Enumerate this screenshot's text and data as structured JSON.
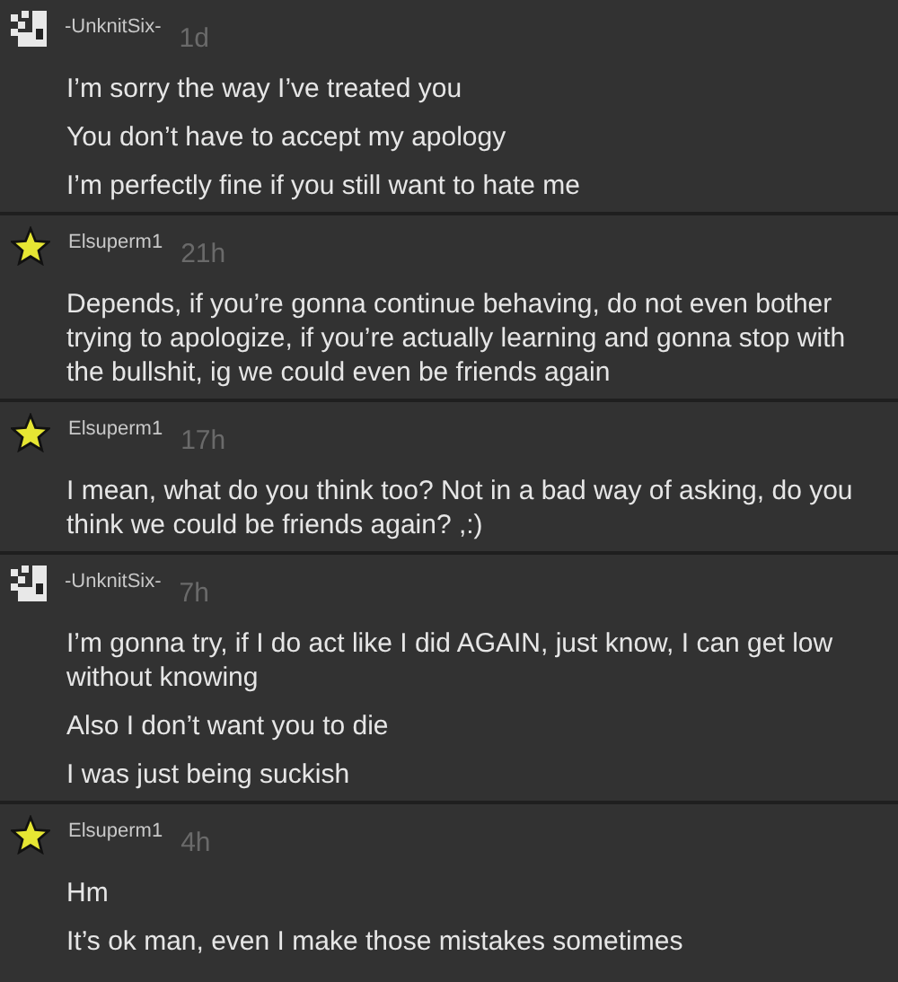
{
  "posts": [
    {
      "kind": "pixel",
      "author": "-UnknitSix-",
      "time": "1d",
      "messages": [
        "I’m sorry the way I’ve treated you",
        "You don’t have to accept my apology",
        "I’m perfectly fine if you still want to hate me"
      ]
    },
    {
      "kind": "star",
      "author": "Elsuperm1",
      "time": "21h",
      "messages": [
        "Depends, if you’re gonna continue behaving, do not even bother trying to apologize, if you’re actually learning and gonna stop with the bullshit, ig we could even be friends again"
      ]
    },
    {
      "kind": "star",
      "author": "Elsuperm1",
      "time": "17h",
      "messages": [
        "I mean, what do you think too? Not in a bad way of asking, do you think we could be friends again? ,:)"
      ]
    },
    {
      "kind": "pixel",
      "author": "-UnknitSix-",
      "time": "7h",
      "messages": [
        "I’m gonna try, if I do act like I did AGAIN, just know, I can get low without knowing",
        "Also I don’t want you to die",
        "I was just being suckish"
      ]
    },
    {
      "kind": "star",
      "author": "Elsuperm1",
      "time": "4h",
      "messages": [
        "Hm",
        "It’s ok man, even I make those mistakes sometimes"
      ]
    }
  ]
}
